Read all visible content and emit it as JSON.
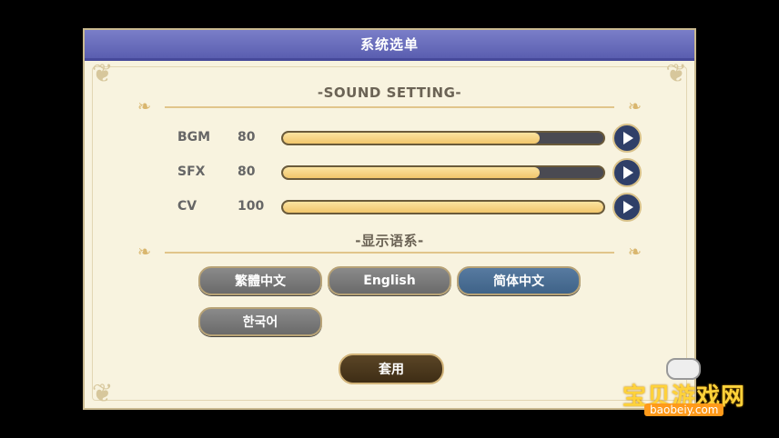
{
  "window": {
    "title": "系统选单"
  },
  "sound": {
    "heading": "-SOUND SETTING-",
    "rows": [
      {
        "label": "BGM",
        "value": "80",
        "level": 0.8
      },
      {
        "label": "SFX",
        "value": "80",
        "level": 0.8
      },
      {
        "label": "CV",
        "value": "100",
        "level": 1.0
      }
    ]
  },
  "language": {
    "heading": "-显示语系-",
    "options": [
      "繁體中文",
      "English",
      "简体中文",
      "한국어"
    ],
    "selected": "简体中文"
  },
  "apply_label": "套用",
  "watermark": {
    "name": "宝贝游戏网",
    "url": "baobeiy.com"
  }
}
